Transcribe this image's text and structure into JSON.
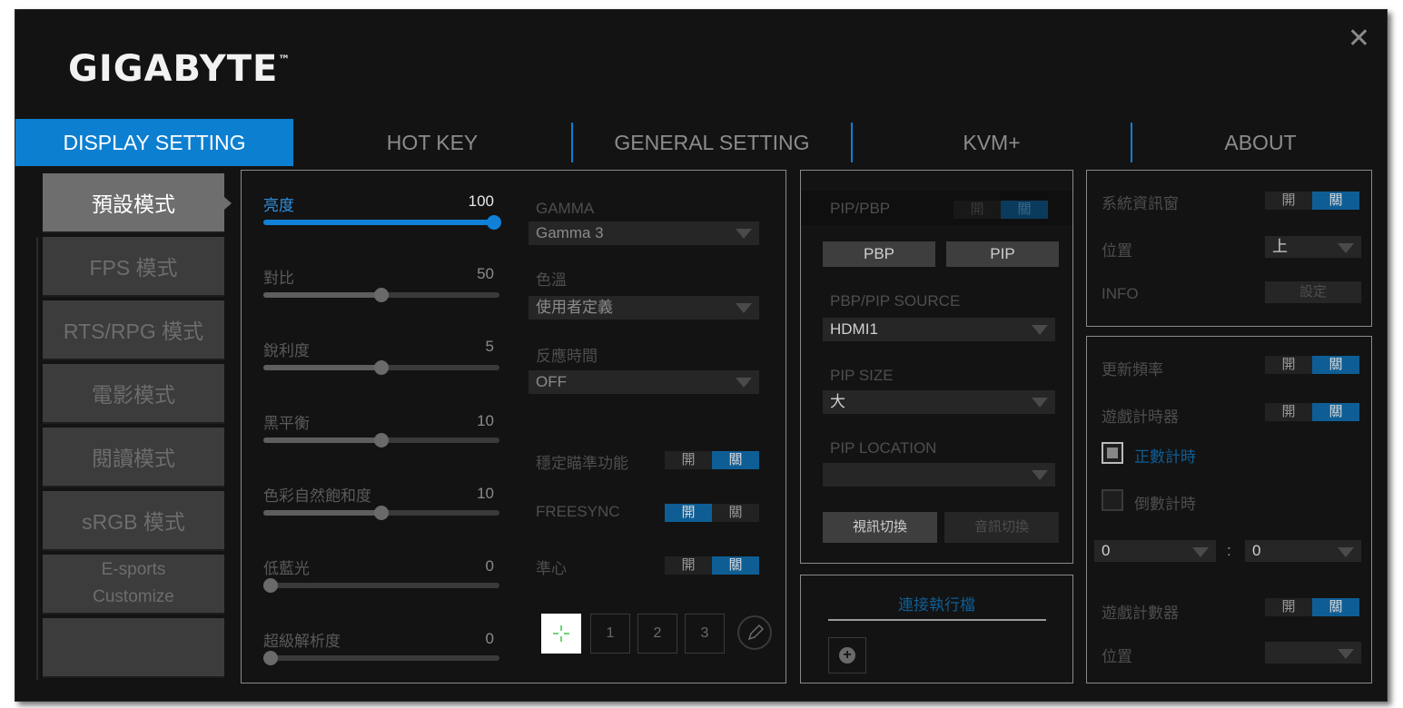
{
  "app": {
    "logo": "GIGABYTE",
    "trademark": "™",
    "close_icon": "close-icon"
  },
  "tabs": [
    {
      "label": "DISPLAY SETTING",
      "active": true
    },
    {
      "label": "HOT KEY",
      "active": false
    },
    {
      "label": "GENERAL SETTING",
      "active": false
    },
    {
      "label": "KVM+",
      "active": false
    },
    {
      "label": "ABOUT",
      "active": false
    }
  ],
  "modes": [
    {
      "label": "預設模式",
      "active": true
    },
    {
      "label": "FPS 模式",
      "active": false
    },
    {
      "label": "RTS/RPG 模式",
      "active": false
    },
    {
      "label": "電影模式",
      "active": false
    },
    {
      "label": "閱讀模式",
      "active": false
    },
    {
      "label": "sRGB 模式",
      "active": false
    },
    {
      "label_line1": "E-sports",
      "label_line2": "Customize",
      "active": false
    },
    {
      "label": "",
      "active": false
    }
  ],
  "sliders": [
    {
      "label": "亮度",
      "value": "100",
      "level": 1.0,
      "active": true
    },
    {
      "label": "對比",
      "value": "50",
      "level": 0.5
    },
    {
      "label": "銳利度",
      "value": "5",
      "level": 0.5
    },
    {
      "label": "黑平衡",
      "value": "10",
      "level": 0.5
    },
    {
      "label": "色彩自然飽和度",
      "value": "10",
      "level": 0.5
    },
    {
      "label": "低藍光",
      "value": "0",
      "level": 0.0
    },
    {
      "label": "超級解析度",
      "value": "0",
      "level": 0.0
    }
  ],
  "picture": {
    "gamma_label": "GAMMA",
    "gamma_value": "Gamma 3",
    "color_temp_label": "色溫",
    "color_temp_value": "使用者定義",
    "response_label": "反應時間",
    "response_value": "OFF",
    "aim_label": "穩定瞄準功能",
    "aim_on": "開",
    "aim_off": "關",
    "freesync_label": "FREESYNC",
    "freesync_on": "開",
    "freesync_off": "關",
    "crosshair_label": "準心",
    "crosshair_on": "開",
    "crosshair_off": "關",
    "crosshair_presets": [
      "1",
      "2",
      "3"
    ]
  },
  "pip": {
    "pip_pbp_label": "PIP/PBP",
    "on": "開",
    "off": "關",
    "pbp_button": "PBP",
    "pip_button": "PIP",
    "source_label": "PBP/PIP SOURCE",
    "source_value": "HDMI1",
    "size_label": "PIP SIZE",
    "size_value": "大",
    "location_label": "PIP LOCATION",
    "location_value": "",
    "video_switch": "視訊切換",
    "audio_switch": "音訊切換"
  },
  "launcher": {
    "label": "連接執行檔"
  },
  "sysinfo": {
    "window_label": "系統資訊窗",
    "on": "開",
    "off": "關",
    "position_label": "位置",
    "position_value": "上",
    "info_label": "INFO",
    "setting_button": "設定"
  },
  "tools": {
    "refresh_label": "更新頻率",
    "on": "開",
    "off": "關",
    "timer_label": "遊戲計時器",
    "count_up": "正數計時",
    "count_down": "倒數計時",
    "time_min": "0",
    "time_sep": ":",
    "time_sec": "0",
    "counter_label": "遊戲計數器",
    "position_label": "位置",
    "position_value": ""
  },
  "colors": {
    "accent": "#0d7fd1",
    "background": "#131313",
    "selected_toggle": "#0e5e95"
  }
}
